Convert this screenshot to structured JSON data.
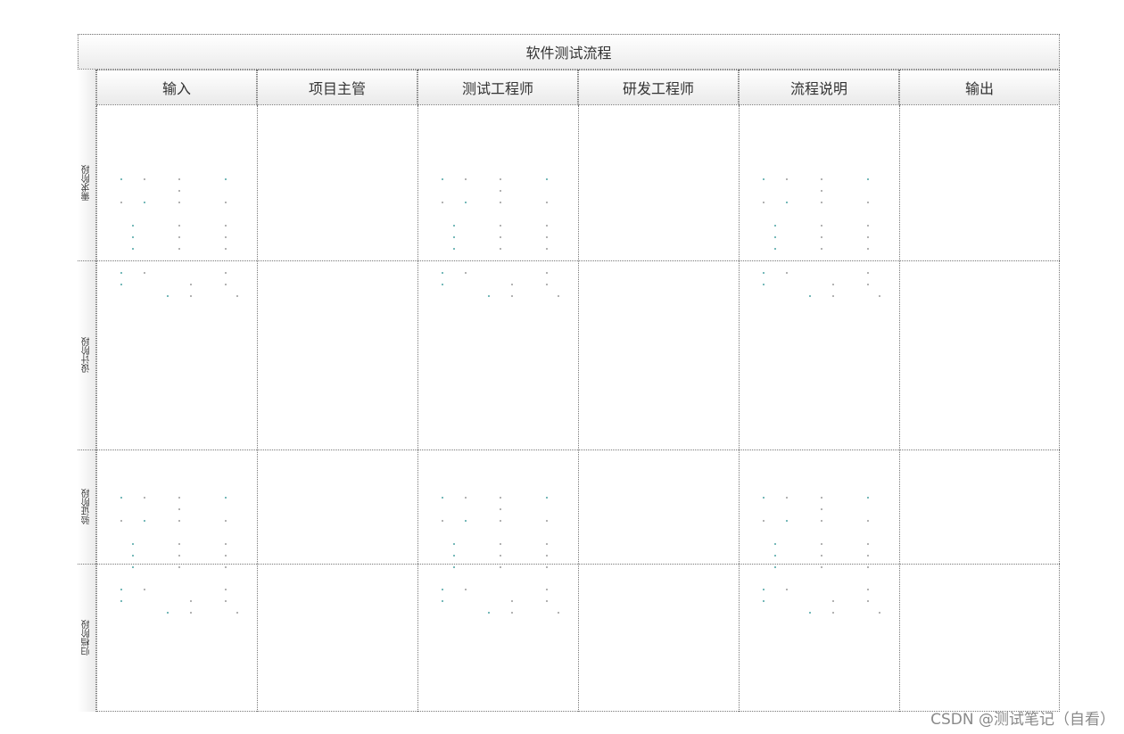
{
  "diagram": {
    "title": "软件测试流程",
    "columns": [
      "输入",
      "项目主管",
      "测试工程师",
      "研发工程师",
      "流程说明",
      "输出"
    ],
    "lanes": [
      "需求阶段",
      "设计阶段",
      "验证阶段",
      "归档阶段"
    ]
  },
  "colors": {
    "border": "#777777",
    "header_gradient_end": "#eaeaea",
    "dot_gray": "#9a9a9a",
    "dot_teal": "#4aa3a3"
  },
  "watermark": "CSDN @测试笔记（自看）"
}
